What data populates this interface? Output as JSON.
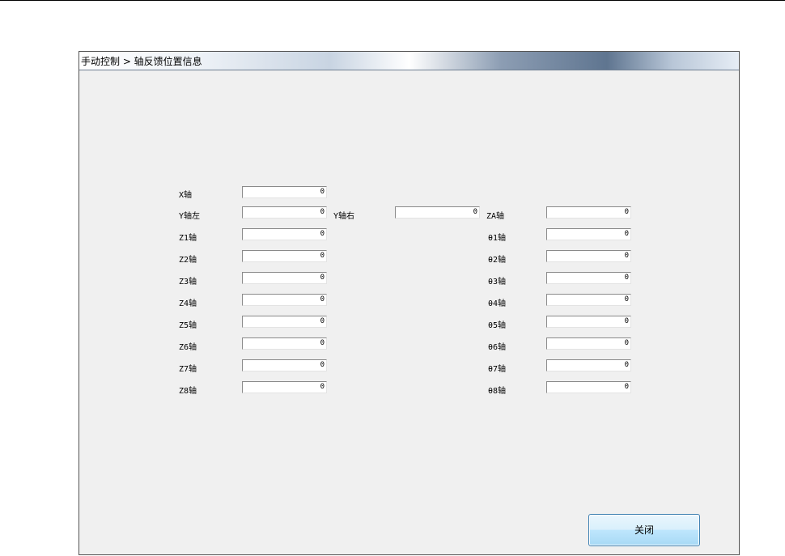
{
  "window": {
    "title": "手动控制 > 轴反馈位置信息"
  },
  "rows": [
    {
      "left_label": "X轴",
      "left_value": "0"
    },
    {
      "left_label": "Y轴左",
      "left_value": "0",
      "mid_label": "Y轴右",
      "mid_value": "0",
      "right_label": "ZA轴",
      "right_value": "0"
    },
    {
      "left_label": "Z1轴",
      "left_value": "0",
      "right_label": "θ1轴",
      "right_value": "0"
    },
    {
      "left_label": "Z2轴",
      "left_value": "0",
      "right_label": "θ2轴",
      "right_value": "0"
    },
    {
      "left_label": "Z3轴",
      "left_value": "0",
      "right_label": "θ3轴",
      "right_value": "0"
    },
    {
      "left_label": "Z4轴",
      "left_value": "0",
      "right_label": "θ4轴",
      "right_value": "0"
    },
    {
      "left_label": "Z5轴",
      "left_value": "0",
      "right_label": "θ5轴",
      "right_value": "0"
    },
    {
      "left_label": "Z6轴",
      "left_value": "0",
      "right_label": "θ6轴",
      "right_value": "0"
    },
    {
      "left_label": "Z7轴",
      "left_value": "0",
      "right_label": "θ7轴",
      "right_value": "0"
    },
    {
      "left_label": "Z8轴",
      "left_value": "0",
      "right_label": "θ8轴",
      "right_value": "0"
    }
  ],
  "buttons": {
    "close": "关闭"
  }
}
